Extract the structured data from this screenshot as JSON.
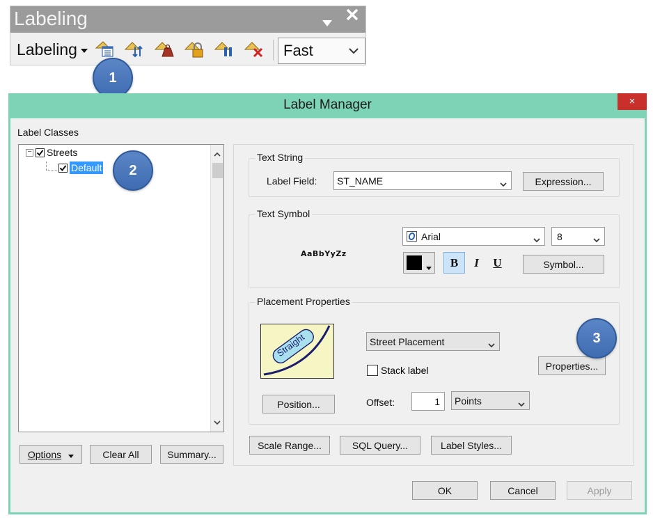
{
  "toolbar": {
    "title": "Labeling",
    "menu_label": "Labeling",
    "quality_value": "Fast",
    "icons": [
      "label-manager-icon",
      "label-priority-icon",
      "label-weights-icon",
      "lock-labels-icon",
      "pause-labeling-icon",
      "view-unplaced-labels-icon"
    ]
  },
  "callouts": [
    "1",
    "2",
    "3"
  ],
  "dialog": {
    "title": "Label Manager",
    "close_label": "×",
    "label_classes_header": "Label Classes",
    "tree": {
      "layer": "Streets",
      "class": "Default"
    },
    "options_button": "Options",
    "clear_all_button": "Clear All",
    "summary_button": "Summary...",
    "text_string": {
      "title": "Text String",
      "label_field_label": "Label Field:",
      "label_field_value": "ST_NAME",
      "expression_button": "Expression..."
    },
    "text_symbol": {
      "title": "Text Symbol",
      "sample": "AaBbYyZz",
      "font_value": "Arial",
      "size_value": "8",
      "bold": "B",
      "italic": "I",
      "underline": "U",
      "symbol_button": "Symbol...",
      "color": "#000000"
    },
    "placement": {
      "title": "Placement Properties",
      "preview_text": "Straight",
      "placement_value": "Street Placement",
      "stack_label": "Stack label",
      "properties_button": "Properties...",
      "position_button": "Position...",
      "offset_label": "Offset:",
      "offset_value": "1",
      "offset_units": "Points"
    },
    "scale_range_button": "Scale Range...",
    "sql_query_button": "SQL Query...",
    "label_styles_button": "Label Styles...",
    "ok_button": "OK",
    "cancel_button": "Cancel",
    "apply_button": "Apply"
  },
  "colors": {
    "dialog_frame": "#7dd3b5",
    "toolbar_title_bar": "#9b9b9b",
    "callout": "#4a76ba",
    "selection": "#3399ff",
    "close_button": "#c9302c"
  }
}
